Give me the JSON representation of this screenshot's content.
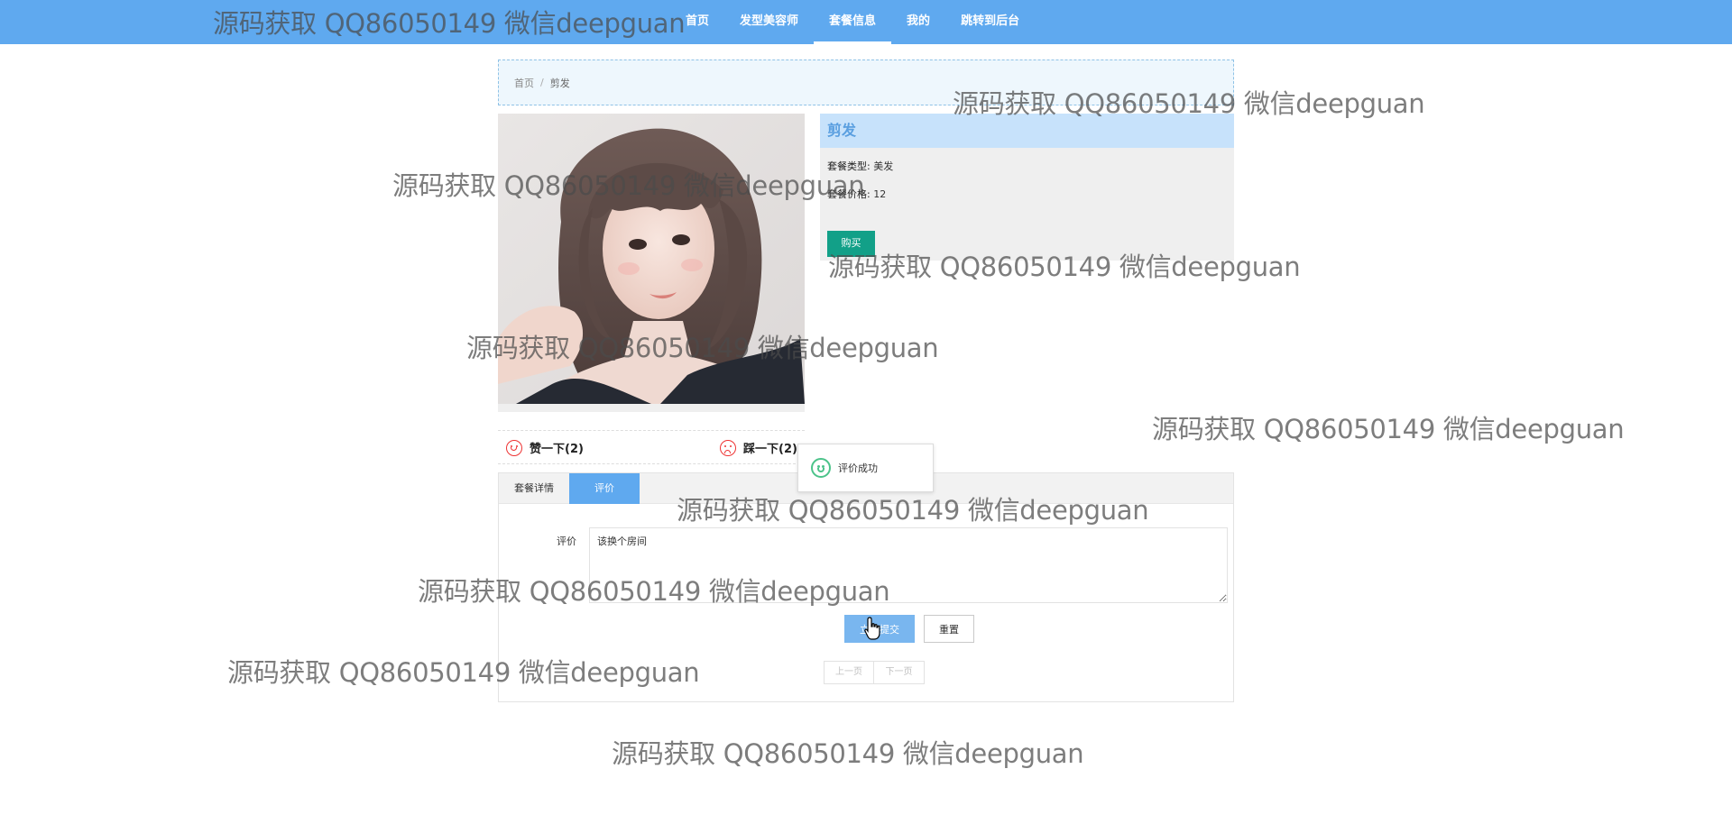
{
  "nav": {
    "items": [
      "首页",
      "发型美容师",
      "套餐信息",
      "我的",
      "跳转到后台"
    ],
    "active_index": 2
  },
  "breadcrumb": {
    "home": "首页",
    "separator": "/",
    "current": "剪发"
  },
  "product": {
    "title": "剪发",
    "type_label": "套餐类型:",
    "type_value": "美发",
    "price_label": "套餐价格:",
    "price_value": "12",
    "buy_label": "购买"
  },
  "vote": {
    "like_label": "赞一下(2)",
    "dislike_label": "踩一下(2)"
  },
  "toast": {
    "message": "评价成功"
  },
  "tabs": {
    "items": [
      "套餐详情",
      "评价"
    ],
    "active_index": 1
  },
  "comment_form": {
    "label": "评价",
    "value": "该换个房间",
    "submit_label": "立即提交",
    "reset_label": "重置"
  },
  "pager": {
    "prev_label": "上一页",
    "next_label": "下一页"
  },
  "watermark": {
    "text": "源码获取 QQ86050149 微信deepguan"
  },
  "colors": {
    "nav_bg": "#5fa9ef",
    "detail_header_bg": "#c7e2fb",
    "buy_button": "#12a088",
    "submit_button": "#79b6ef",
    "vote_icon": "#ee3333",
    "toast_icon": "#4cc38a"
  },
  "icons": {
    "like": "smile-icon",
    "dislike": "frown-icon",
    "toast": "success-smile-icon",
    "cursor": "hand-pointer-icon"
  }
}
